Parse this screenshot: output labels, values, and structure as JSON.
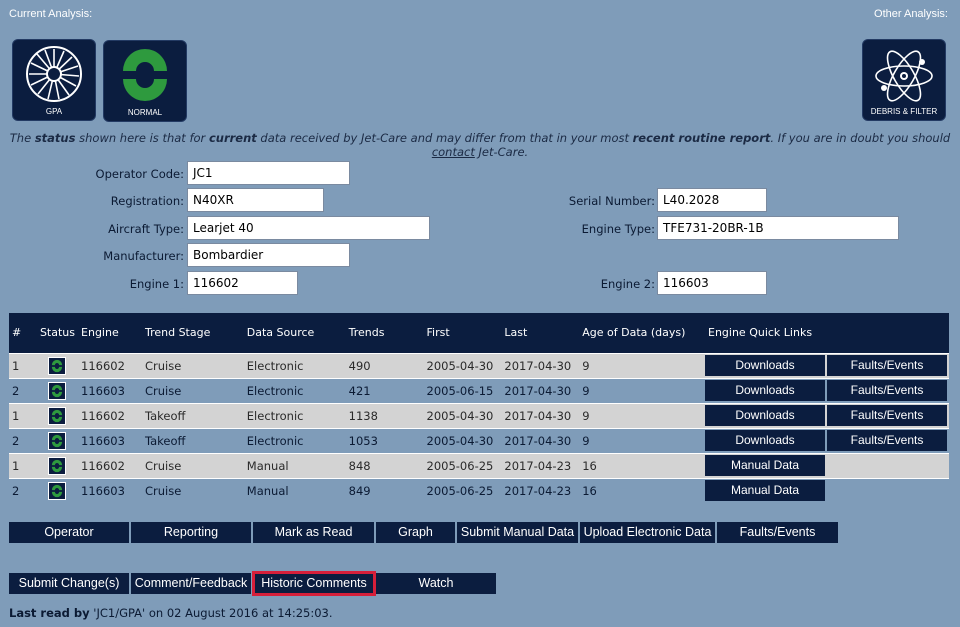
{
  "header": {
    "current_analysis": "Current Analysis:",
    "other_analysis": "Other Analysis:"
  },
  "tiles": {
    "gpa": "GPA",
    "normal": "NORMAL",
    "debris": "DEBRIS & FILTER"
  },
  "notice": {
    "t1": "The ",
    "b1": "status",
    "t2": " shown here is that for ",
    "b2": "current",
    "t3": " data received by Jet-Care and may differ from that in your most ",
    "b3": "recent routine report",
    "t4": ". If you are in doubt you should ",
    "link": "contact",
    "t5": " Jet-Care."
  },
  "form": {
    "operator_code_label": "Operator Code:",
    "operator_code": "JC1",
    "registration_label": "Registration:",
    "registration": "N40XR",
    "aircraft_type_label": "Aircraft Type:",
    "aircraft_type": "Learjet 40",
    "manufacturer_label": "Manufacturer:",
    "manufacturer": "Bombardier",
    "engine1_label": "Engine 1:",
    "engine1": "116602",
    "serial_label": "Serial Number:",
    "serial": "L40.2028",
    "engine_type_label": "Engine Type:",
    "engine_type": "TFE731-20BR-1B",
    "engine2_label": "Engine 2:",
    "engine2": "116603"
  },
  "table": {
    "headers": [
      "#",
      "Status",
      "Engine",
      "Trend Stage",
      "Data Source",
      "Trends",
      "First",
      "Last",
      "Age of Data (days)",
      "Engine Quick Links"
    ],
    "rows": [
      {
        "num": "1",
        "engine": "116602",
        "stage": "Cruise",
        "source": "Electronic",
        "trends": "490",
        "first": "2005-04-30",
        "last": "2017-04-30",
        "age": "9",
        "links": [
          "Downloads",
          "Faults/Events"
        ]
      },
      {
        "num": "2",
        "engine": "116603",
        "stage": "Cruise",
        "source": "Electronic",
        "trends": "421",
        "first": "2005-06-15",
        "last": "2017-04-30",
        "age": "9",
        "links": [
          "Downloads",
          "Faults/Events"
        ]
      },
      {
        "num": "1",
        "engine": "116602",
        "stage": "Takeoff",
        "source": "Electronic",
        "trends": "1138",
        "first": "2005-04-30",
        "last": "2017-04-30",
        "age": "9",
        "links": [
          "Downloads",
          "Faults/Events"
        ]
      },
      {
        "num": "2",
        "engine": "116603",
        "stage": "Takeoff",
        "source": "Electronic",
        "trends": "1053",
        "first": "2005-04-30",
        "last": "2017-04-30",
        "age": "9",
        "links": [
          "Downloads",
          "Faults/Events"
        ]
      },
      {
        "num": "1",
        "engine": "116602",
        "stage": "Cruise",
        "source": "Manual",
        "trends": "848",
        "first": "2005-06-25",
        "last": "2017-04-23",
        "age": "16",
        "links": [
          "Manual Data"
        ]
      },
      {
        "num": "2",
        "engine": "116603",
        "stage": "Cruise",
        "source": "Manual",
        "trends": "849",
        "first": "2005-06-25",
        "last": "2017-04-23",
        "age": "16",
        "links": [
          "Manual Data"
        ]
      }
    ]
  },
  "nav1": [
    "Operator",
    "Reporting",
    "Mark as Read",
    "Graph",
    "Submit Manual Data",
    "Upload Electronic Data",
    "Faults/Events"
  ],
  "nav2": [
    "Submit Change(s)",
    "Comment/Feedback",
    "Historic Comments",
    "Watch"
  ],
  "lastread": {
    "label": "Last read by",
    "user": " 'JC1/GPA'",
    "on": " on ",
    "date": "02 August 2016",
    "at": " at ",
    "time": "14:25:03",
    "end": "."
  },
  "colors": {
    "background": "#7f9cb9",
    "navy": "#0b1d3f",
    "status_green": "#2e9a3e",
    "highlight": "#d61f3a"
  }
}
